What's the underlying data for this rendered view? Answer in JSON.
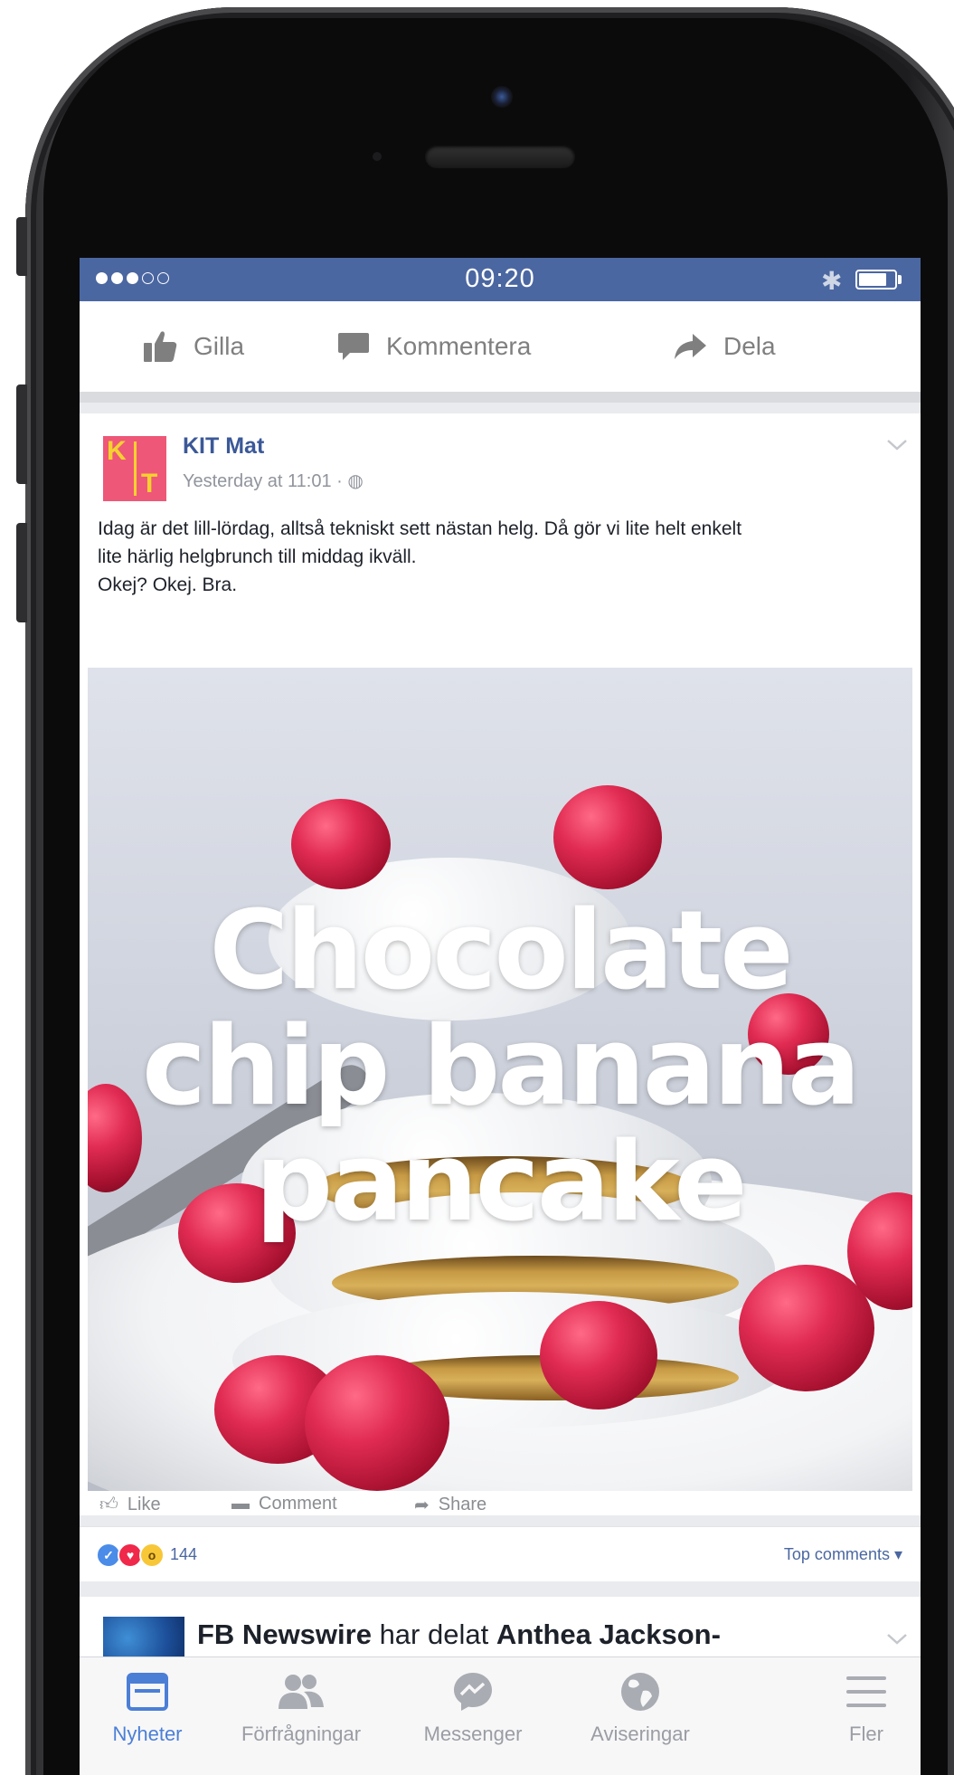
{
  "status_bar": {
    "time": "09:20",
    "signal_dots_full": 3,
    "signal_dots_empty": 2,
    "battery_level": 0.8,
    "color": "#4b67a1"
  },
  "top_actions": {
    "like": "Gilla",
    "comment": "Kommentera",
    "share": "Dela"
  },
  "post": {
    "avatar_letters": [
      "K",
      "I",
      "T"
    ],
    "page_name": "KIT Mat",
    "timestamp": "Yesterday at 11:01 · ",
    "text_lines": [
      "Idag är det lill-lördag, alltså tekniskt sett nästan helg. Då gör vi lite helt enkelt",
      "lite härlig helgbrunch till middag ikväll.",
      "Okej? Okej. Bra."
    ],
    "video_title_lines": [
      "Chocolate",
      "chip banana",
      "pancake"
    ],
    "mini_actions": {
      "like": "Like",
      "comment": "Comment",
      "share": "Share"
    },
    "reaction_count": "144",
    "top_comments": "Top comments ▾"
  },
  "next_post": {
    "author": "FB Newswire",
    "middle": " har delat ",
    "shared_from": "Anthea Jackson-"
  },
  "tab_bar": {
    "tabs": [
      {
        "label": "Nyheter",
        "icon": "news-feed-icon",
        "active": true
      },
      {
        "label": "Förfrågningar",
        "icon": "friend-requests-icon",
        "active": false
      },
      {
        "label": "Messenger",
        "icon": "messenger-icon",
        "active": false
      },
      {
        "label": "Aviseringar",
        "icon": "globe-icon",
        "active": false
      },
      {
        "label": "Fler",
        "icon": "menu-icon",
        "active": false
      }
    ]
  },
  "colors": {
    "facebook_blue": "#3b5998",
    "accent": "#4b7fd6",
    "muted": "#7f7f7f"
  }
}
